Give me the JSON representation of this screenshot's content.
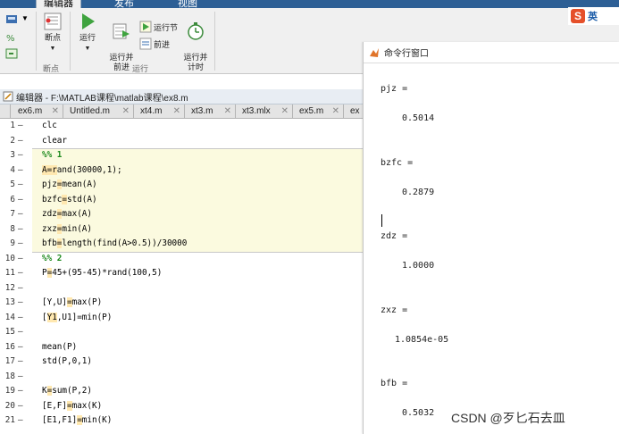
{
  "ribbon": {
    "tabs": [
      "编辑器",
      "发布",
      "视图"
    ],
    "breakpoints_label": "断点",
    "run_label": "运行",
    "run_advance_label": "运行并\n前进",
    "run_section_label": "运行节",
    "advance_label": "前进",
    "run_time_label": "运行并\n计时",
    "group_breakpoints": "断点",
    "group_run": "运行"
  },
  "ime": {
    "lang": "英"
  },
  "editor": {
    "title": "编辑器 - F:\\MATLAB课程\\matlab课程\\ex8.m",
    "tabs": [
      "ex6.m",
      "Untitled.m",
      "xt4.m",
      "xt3.m",
      "xt3.mlx",
      "ex5.m",
      "ex"
    ],
    "lines": [
      "clc",
      "clear",
      "%% 1",
      "A=rand(30000,1);",
      "pjz=mean(A)",
      "bzfc=std(A)",
      "zdz=max(A)",
      "zxz=min(A)",
      "bfb=length(find(A>0.5))/30000",
      "%% 2",
      "P=45+(95-45)*rand(100,5)",
      "",
      "[Y,U]=max(P)",
      "[Y1,U1]=min(P)",
      "",
      "mean(P)",
      "std(P,0,1)",
      "",
      "K=sum(P,2)",
      "[E,F]=max(K)",
      "[E1,F1]=min(K)"
    ],
    "line_numbers": [
      "1",
      "2",
      "3",
      "4",
      "5",
      "6",
      "7",
      "8",
      "9",
      "10",
      "11",
      "12",
      "13",
      "14",
      "15",
      "16",
      "17",
      "18",
      "19",
      "20",
      "21"
    ]
  },
  "command_window": {
    "title": "命令行窗口",
    "output": [
      {
        "name": "pjz =",
        "value": "0.5014"
      },
      {
        "name": "bzfc =",
        "value": "0.2879"
      },
      {
        "name": "zdz =",
        "value": "1.0000"
      },
      {
        "name": "zxz =",
        "value": "1.0854e-05"
      },
      {
        "name": "bfb =",
        "value": "0.5032"
      }
    ]
  },
  "watermark": "CSDN @歹匕石去皿"
}
